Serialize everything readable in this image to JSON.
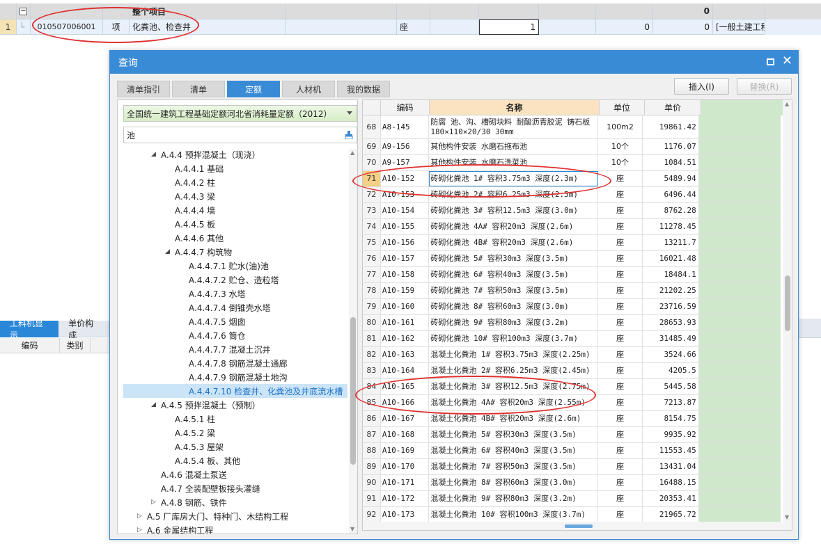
{
  "background": {
    "row0": {
      "label": "整个项目",
      "total": "0"
    },
    "row1": {
      "num": "1",
      "code": "010507006001",
      "type": "项",
      "name": "化粪池、检查井",
      "unit": "座",
      "qty": "1",
      "v1": "0",
      "v2": "0",
      "extra": "[一般土建工程"
    },
    "lower_tabs": [
      "工料机显示",
      "单价构成"
    ],
    "lower_headers": [
      "编码",
      "类别"
    ]
  },
  "dialog": {
    "title": "查询",
    "tabs": [
      "清单指引",
      "清单",
      "定额",
      "人材机",
      "我的数据"
    ],
    "active_tab": "定额",
    "insert_label": "插入(I)",
    "replace_label": "替换(R)",
    "quota_library": "全国统一建筑工程基础定额河北省消耗量定额（2012）",
    "search_value": "池",
    "tree": [
      {
        "label": "A.4.4 预拌混凝土（现浇）",
        "level": 1,
        "toggle": "◢"
      },
      {
        "label": "A.4.4.1 基础",
        "level": 2,
        "toggle": ""
      },
      {
        "label": "A.4.4.2 柱",
        "level": 2,
        "toggle": ""
      },
      {
        "label": "A.4.4.3 梁",
        "level": 2,
        "toggle": ""
      },
      {
        "label": "A.4.4.4 墙",
        "level": 2,
        "toggle": ""
      },
      {
        "label": "A.4.4.5 板",
        "level": 2,
        "toggle": ""
      },
      {
        "label": "A.4.4.6 其他",
        "level": 2,
        "toggle": ""
      },
      {
        "label": "A.4.4.7 构筑物",
        "level": 2,
        "toggle": "◢"
      },
      {
        "label": "A.4.4.7.1 贮水(油)池",
        "level": 3,
        "toggle": ""
      },
      {
        "label": "A.4.4.7.2 贮仓、造粒塔",
        "level": 3,
        "toggle": ""
      },
      {
        "label": "A.4.4.7.3 水塔",
        "level": 3,
        "toggle": ""
      },
      {
        "label": "A.4.4.7.4 倒锥壳水塔",
        "level": 3,
        "toggle": ""
      },
      {
        "label": "A.4.4.7.5 烟囱",
        "level": 3,
        "toggle": ""
      },
      {
        "label": "A.4.4.7.6 筒仓",
        "level": 3,
        "toggle": ""
      },
      {
        "label": "A.4.4.7.7 混凝土沉井",
        "level": 3,
        "toggle": ""
      },
      {
        "label": "A.4.4.7.8 钢筋混凝土通廊",
        "level": 3,
        "toggle": ""
      },
      {
        "label": "A.4.4.7.9 钢筋混凝土地沟",
        "level": 3,
        "toggle": ""
      },
      {
        "label": "A.4.4.7.10 检查井、化粪池及井底流水槽",
        "level": 3,
        "toggle": "",
        "selected": true
      },
      {
        "label": "A.4.5 预拌混凝土（预制）",
        "level": 1,
        "toggle": "◢"
      },
      {
        "label": "A.4.5.1 柱",
        "level": 2,
        "toggle": ""
      },
      {
        "label": "A.4.5.2 梁",
        "level": 2,
        "toggle": ""
      },
      {
        "label": "A.4.5.3 屋架",
        "level": 2,
        "toggle": ""
      },
      {
        "label": "A.4.5.4 板、其他",
        "level": 2,
        "toggle": ""
      },
      {
        "label": "A.4.6 混凝土泵送",
        "level": 1,
        "toggle": ""
      },
      {
        "label": "A.4.7 全装配壁板接头灌缝",
        "level": 1,
        "toggle": ""
      },
      {
        "label": "A.4.8 钢筋、铁件",
        "level": 1,
        "toggle": "▷"
      },
      {
        "label": "A.5 厂库房大门、特种门、木结构工程",
        "level": 0,
        "toggle": "▷"
      },
      {
        "label": "A.6 金属结构工程",
        "level": 0,
        "toggle": "▷"
      }
    ],
    "grid_headers": [
      "编码",
      "名称",
      "单位",
      "单价"
    ],
    "grid_rows": [
      {
        "no": "68",
        "code": "A8-145",
        "name": "防腐 池、沟、槽砌块料 耐酸沥青胶泥 铸石板 180×110×20/30 30mm",
        "unit": "100m2",
        "price": "19861.42"
      },
      {
        "no": "69",
        "code": "A9-156",
        "name": "其他构件安装 水磨石拖布池",
        "unit": "10个",
        "price": "1176.07"
      },
      {
        "no": "70",
        "code": "A9-157",
        "name": "其他构件安装 水磨石洗菜池",
        "unit": "10个",
        "price": "1084.51"
      },
      {
        "no": "71",
        "code": "A10-152",
        "name": "砖砌化粪池 1# 容积3.75m3 深度(2.3m)",
        "unit": "座",
        "price": "5489.94",
        "current": true
      },
      {
        "no": "72",
        "code": "A10-153",
        "name": "砖砌化粪池 2# 容积6.25m3 深度(2.5m)",
        "unit": "座",
        "price": "6496.44"
      },
      {
        "no": "73",
        "code": "A10-154",
        "name": "砖砌化粪池 3# 容积12.5m3 深度(3.0m)",
        "unit": "座",
        "price": "8762.28"
      },
      {
        "no": "74",
        "code": "A10-155",
        "name": "砖砌化粪池 4A# 容积20m3 深度(2.6m)",
        "unit": "座",
        "price": "11278.45"
      },
      {
        "no": "75",
        "code": "A10-156",
        "name": "砖砌化粪池 4B# 容积20m3 深度(2.6m)",
        "unit": "座",
        "price": "13211.7"
      },
      {
        "no": "76",
        "code": "A10-157",
        "name": "砖砌化粪池 5# 容积30m3 深度(3.5m)",
        "unit": "座",
        "price": "16021.48"
      },
      {
        "no": "77",
        "code": "A10-158",
        "name": "砖砌化粪池 6# 容积40m3 深度(3.5m)",
        "unit": "座",
        "price": "18484.1"
      },
      {
        "no": "78",
        "code": "A10-159",
        "name": "砖砌化粪池 7# 容积50m3 深度(3.5m)",
        "unit": "座",
        "price": "21202.25"
      },
      {
        "no": "79",
        "code": "A10-160",
        "name": "砖砌化粪池 8# 容积60m3 深度(3.0m)",
        "unit": "座",
        "price": "23716.59"
      },
      {
        "no": "80",
        "code": "A10-161",
        "name": "砖砌化粪池 9# 容积80m3 深度(3.2m)",
        "unit": "座",
        "price": "28653.93"
      },
      {
        "no": "81",
        "code": "A10-162",
        "name": "砖砌化粪池 10# 容积100m3 深度(3.7m)",
        "unit": "座",
        "price": "31485.49"
      },
      {
        "no": "82",
        "code": "A10-163",
        "name": "混凝土化粪池 1# 容积3.75m3 深度(2.25m)",
        "unit": "座",
        "price": "3524.66"
      },
      {
        "no": "83",
        "code": "A10-164",
        "name": "混凝土化粪池 2# 容积6.25m3 深度(2.45m)",
        "unit": "座",
        "price": "4205.5"
      },
      {
        "no": "84",
        "code": "A10-165",
        "name": "混凝土化粪池 3# 容积12.5m3 深度(2.75m)",
        "unit": "座",
        "price": "5445.58"
      },
      {
        "no": "85",
        "code": "A10-166",
        "name": "混凝土化粪池 4A# 容积20m3 深度(2.55m)",
        "unit": "座",
        "price": "7213.87"
      },
      {
        "no": "86",
        "code": "A10-167",
        "name": "混凝土化粪池 4B# 容积20m3 深度(2.6m)",
        "unit": "座",
        "price": "8154.75"
      },
      {
        "no": "87",
        "code": "A10-168",
        "name": "混凝土化粪池 5# 容积30m3 深度(3.5m)",
        "unit": "座",
        "price": "9935.92"
      },
      {
        "no": "88",
        "code": "A10-169",
        "name": "混凝土化粪池 6# 容积40m3 深度(3.5m)",
        "unit": "座",
        "price": "11553.45"
      },
      {
        "no": "89",
        "code": "A10-170",
        "name": "混凝土化粪池 7# 容积50m3 深度(3.5m)",
        "unit": "座",
        "price": "13431.04"
      },
      {
        "no": "90",
        "code": "A10-171",
        "name": "混凝土化粪池 8# 容积60m3 深度(3.0m)",
        "unit": "座",
        "price": "16488.15"
      },
      {
        "no": "91",
        "code": "A10-172",
        "name": "混凝土化粪池 9# 容积80m3 深度(3.2m)",
        "unit": "座",
        "price": "20353.41"
      },
      {
        "no": "92",
        "code": "A10-173",
        "name": "混凝土化粪池 10# 容积100m3 深度(3.7m)",
        "unit": "座",
        "price": "21965.72"
      }
    ]
  },
  "colors": {
    "accent": "#3a8bd6",
    "annotation": "#e03030",
    "selected_row": "#f4cf86",
    "name_header": "#fbe3c2",
    "green_fill": "#cfe8cc"
  }
}
